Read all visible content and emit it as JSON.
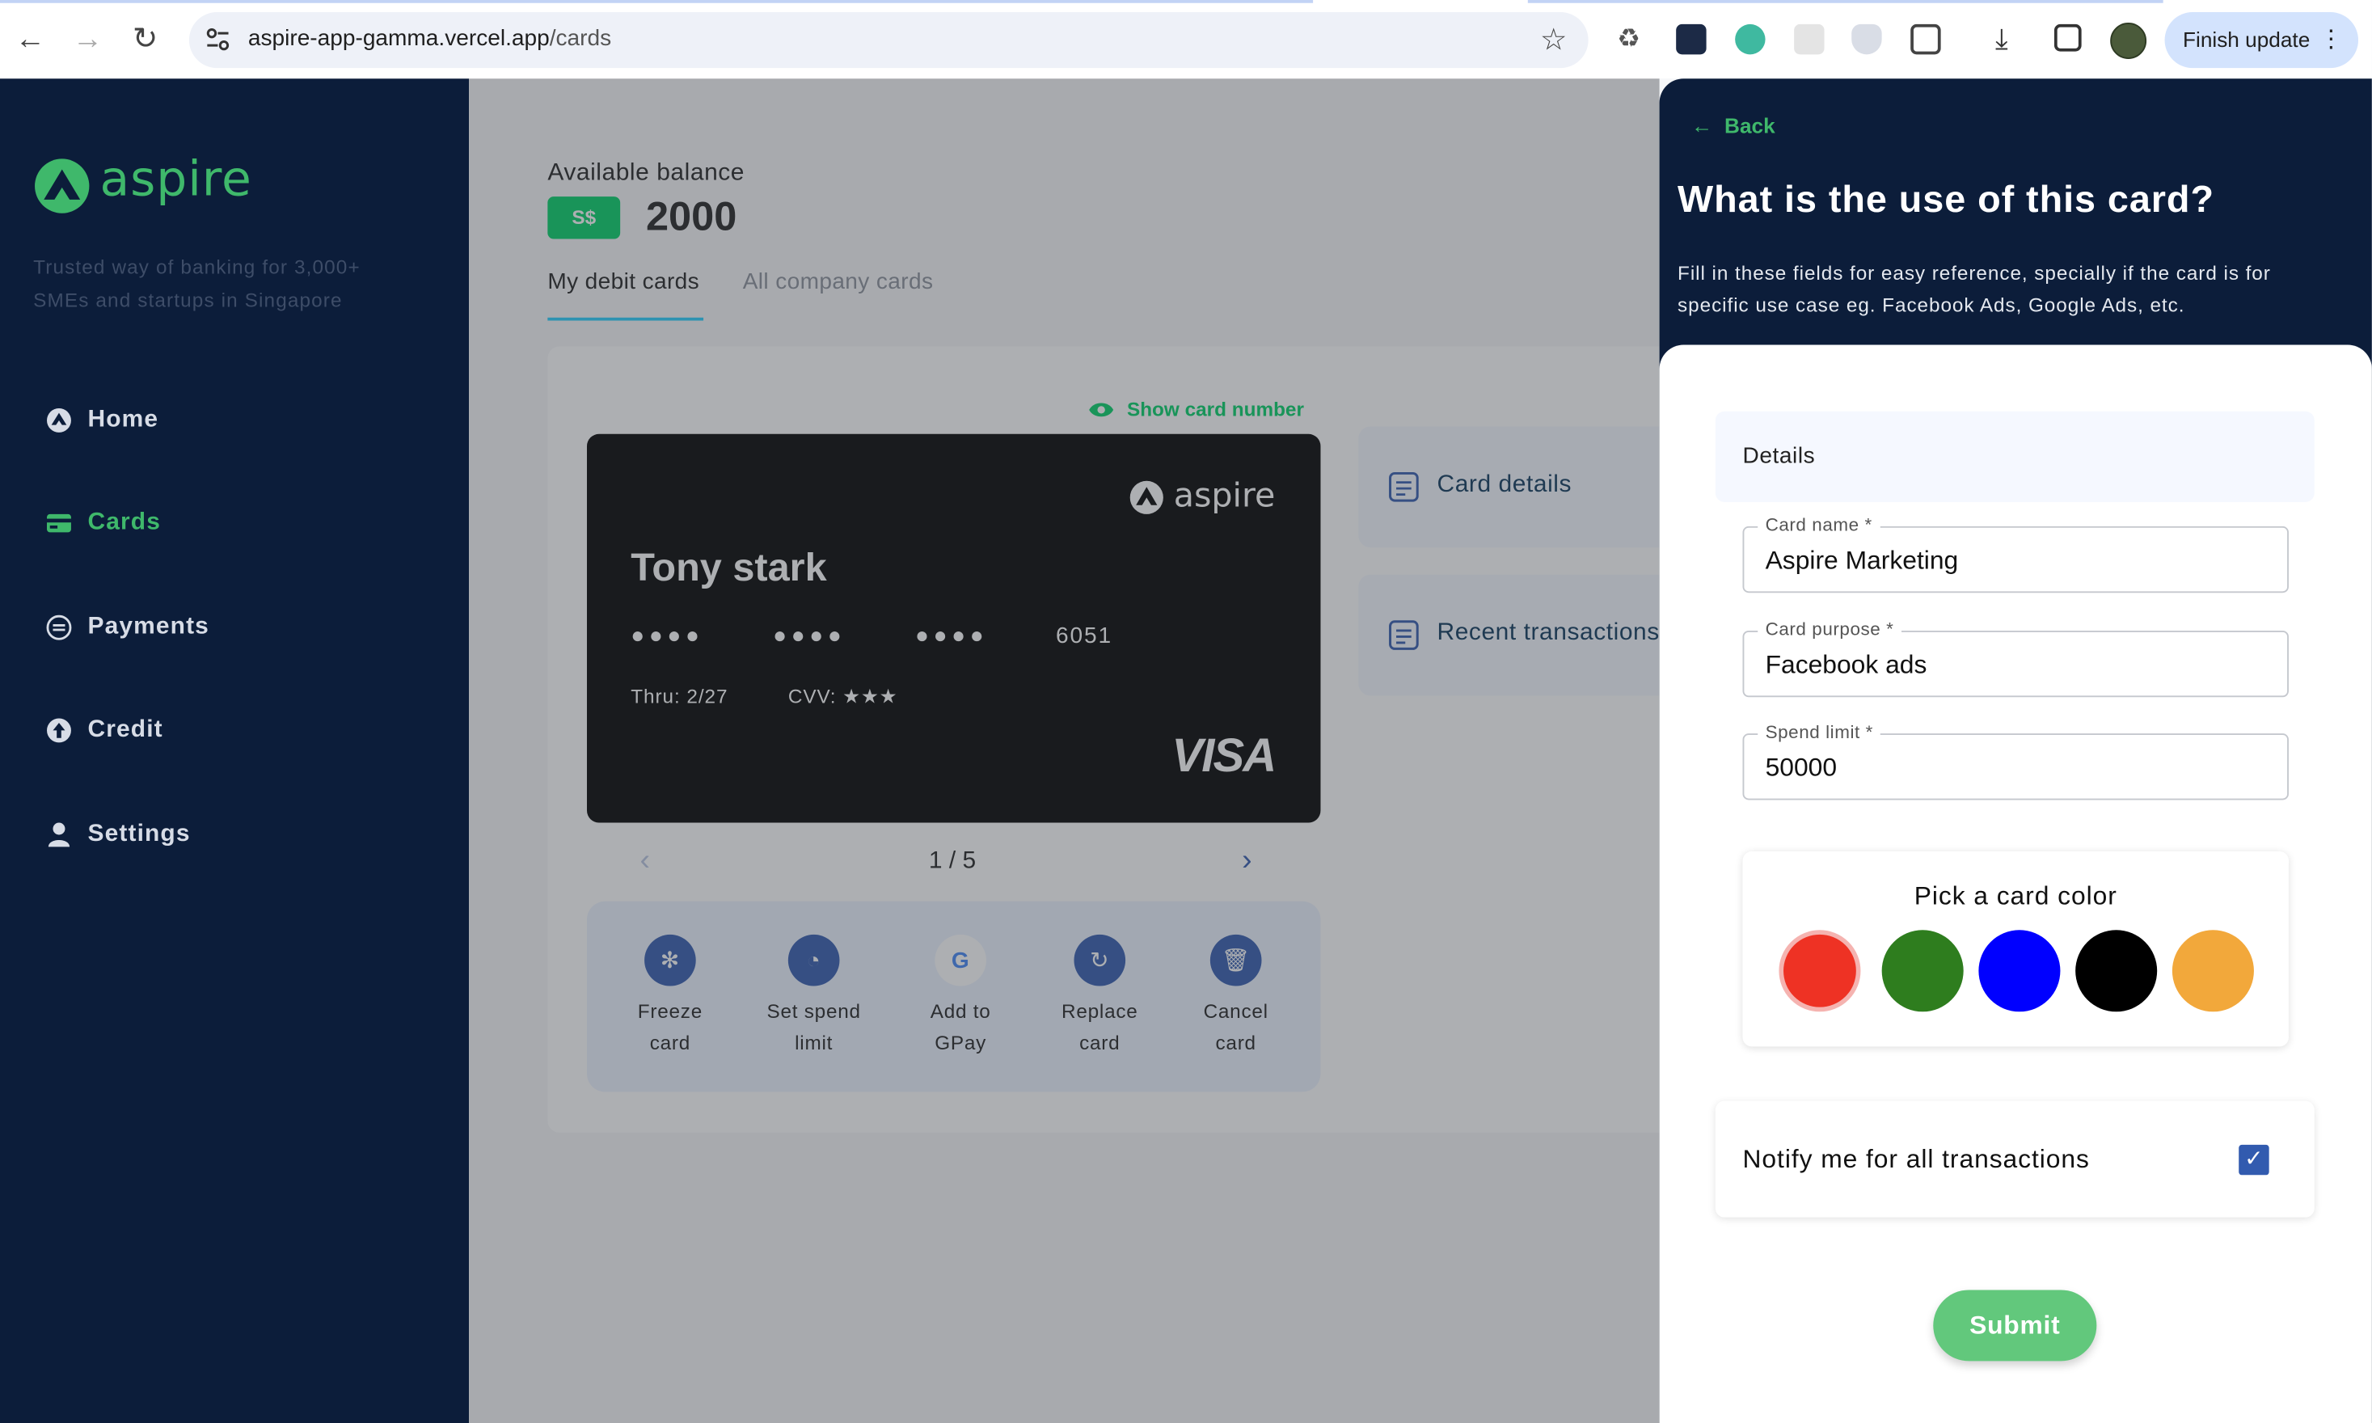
{
  "browser": {
    "url_host": "aspire-app-gamma.vercel.app",
    "url_path": "/cards",
    "finish_update": "Finish update"
  },
  "sidebar": {
    "logo_text": "aspire",
    "tagline": "Trusted way of banking for 3,000+ SMEs and startups in Singapore",
    "items": [
      {
        "label": "Home",
        "icon": "home-icon"
      },
      {
        "label": "Cards",
        "icon": "card-icon",
        "active": true
      },
      {
        "label": "Payments",
        "icon": "payments-icon"
      },
      {
        "label": "Credit",
        "icon": "credit-icon"
      },
      {
        "label": "Settings",
        "icon": "user-icon"
      }
    ]
  },
  "main": {
    "balance_label": "Available balance",
    "currency": "S$",
    "balance": "2000",
    "tabs": [
      {
        "label": "My debit cards",
        "active": true
      },
      {
        "label": "All company cards"
      }
    ],
    "show_card_number": "Show card number",
    "card": {
      "brand_logo": "aspire",
      "holder": "Tony stark",
      "masked_groups": [
        "●●●●",
        "●●●●",
        "●●●●"
      ],
      "last4": "6051",
      "thru": "Thru: 2/27",
      "cvv": "CVV: ★★★",
      "network": "VISA"
    },
    "pager": "1 / 5",
    "actions": [
      {
        "label": "Freeze card",
        "icon": "snowflake-icon"
      },
      {
        "label": "Set spend limit",
        "icon": "gauge-icon"
      },
      {
        "label": "Add to GPay",
        "icon": "google-icon"
      },
      {
        "label": "Replace card",
        "icon": "replace-icon"
      },
      {
        "label": "Cancel card",
        "icon": "trash-icon"
      }
    ],
    "side_cards": [
      {
        "label": "Card details",
        "icon": "document-icon"
      },
      {
        "label": "Recent transactions",
        "icon": "document-icon"
      }
    ]
  },
  "drawer": {
    "back": "Back",
    "title": "What is the use of this card?",
    "subtitle": "Fill in these fields for easy reference, specially if the card is for specific use case eg. Facebook Ads, Google Ads, etc.",
    "section": "Details",
    "fields": [
      {
        "label": "Card name",
        "value": "Aspire Marketing"
      },
      {
        "label": "Card purpose",
        "value": "Facebook ads"
      },
      {
        "label": "Spend limit",
        "value": "50000"
      }
    ],
    "color_title": "Pick a card color",
    "colors": [
      "#ee3224",
      "#2e7d1e",
      "#0000ff",
      "#000000",
      "#f2a83b"
    ],
    "selected_color": "#ee3224",
    "notify_label": "Notify me for all transactions",
    "notify_checked": true,
    "submit": "Submit"
  }
}
